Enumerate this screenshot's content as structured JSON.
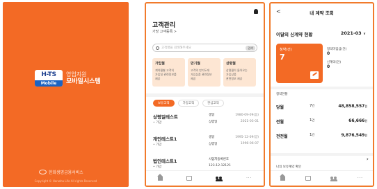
{
  "splash": {
    "logo_top": "H-TS",
    "logo_bottom": "Mobile",
    "brand_line1": "영업지원",
    "brand_line2": "모바일시스템",
    "company": "한화생명금융서비스",
    "copyright": "Copyright © Hanwha Life All rights Reserved",
    "bg_color": "#f36a25"
  },
  "customers": {
    "title": "고객관리",
    "subtitle": "가망 고객등록 >",
    "search": {
      "placeholder": "고객명을 검색해주세요",
      "button_label": "검색"
    },
    "cards": [
      {
        "title": "가입월",
        "desc": [
          "계약월별 고객의",
          "가입일 관련정보를",
          "제공"
        ]
      },
      {
        "title": "만기월",
        "desc": [
          "고객의 만기도래",
          "가입상품 관련정보",
          "제공"
        ]
      },
      {
        "title": "상령월",
        "desc": [
          "상령월이 돌아오는",
          "가입상품",
          "관련정보 제공"
        ]
      }
    ],
    "filters": [
      "보유고객",
      "가망고객",
      "관심고객"
    ],
    "rows": [
      {
        "name": "상령일테스트",
        "sub": "• 가망",
        "k1": "생일",
        "v1": "1980-09-09(음)",
        "k2": "상령일",
        "v2": "2021-03-01"
      },
      {
        "name": "개인테스트1",
        "sub": "• 가망",
        "k1": "생일",
        "v1": "1995-12-09(양)",
        "k2": "상령일",
        "v2": "1996-06-07"
      },
      {
        "name": "법인테스트1",
        "sub": "• 가망",
        "k1": "사업자등록번호",
        "v1": "",
        "k2": "123-12-12121",
        "v2": ""
      }
    ],
    "tabs": [
      "home-icon",
      "calendar-icon",
      "customers-icon",
      "more-icon"
    ]
  },
  "contracts": {
    "header": "내 계약 조회",
    "section_title": "이달의 신계약 현황",
    "month": "2021-03",
    "month_caret": "∨",
    "ok_card": {
      "label": "청약(건)",
      "count": "7"
    },
    "stats": [
      {
        "label": "청약미입금(건)",
        "value": "0"
      },
      {
        "label": "신계약(건)",
        "value": "0"
      }
    ],
    "status_title": "청약현황",
    "status_rows": [
      {
        "key": "당월",
        "count": "7",
        "count_unit": "건",
        "amount": "48,858,557",
        "amount_unit": "원"
      },
      {
        "key": "전월",
        "count": "1",
        "count_unit": "건",
        "amount": "66,666",
        "amount_unit": "원"
      },
      {
        "key": "전전월",
        "count": "1",
        "count_unit": "건",
        "amount": "9,876,549",
        "amount_unit": "원"
      }
    ],
    "register_link": "나의 보유계약 확인",
    "register_chevron": "›",
    "back_label": "<",
    "tabs": [
      "home-icon",
      "calendar-icon",
      "customers-icon",
      "more-icon"
    ]
  }
}
